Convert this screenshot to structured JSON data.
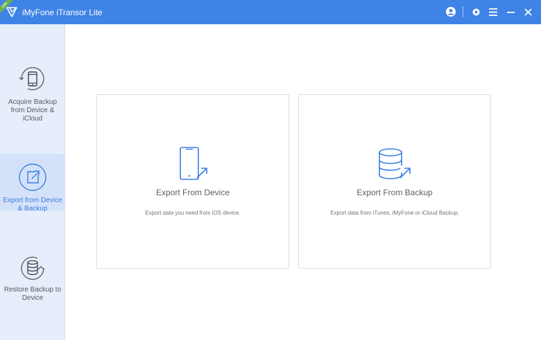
{
  "app": {
    "title": "iMyFone iTransor Lite",
    "ribbon": "Lite",
    "accent_color": "#3f83e6"
  },
  "titlebar_icons": [
    "account-icon",
    "settings-icon",
    "menu-icon",
    "minimize-icon",
    "close-icon"
  ],
  "sidebar": {
    "items": [
      {
        "label": "Acquire Backup from Device & iCloud",
        "icon": "phone-backup-icon",
        "active": false
      },
      {
        "label": "Export from Device & Backup",
        "icon": "export-icon",
        "active": true
      },
      {
        "label": "Restore Backup to Device",
        "icon": "database-restore-icon",
        "active": false
      }
    ]
  },
  "cards": [
    {
      "title": "Export From Device",
      "description": "Export data you need from iOS device.",
      "icon": "phone-export-icon"
    },
    {
      "title": "Export From Backup",
      "description": "Export data from iTunes, iMyFone or iCloud Backup.",
      "icon": "database-export-icon"
    }
  ]
}
